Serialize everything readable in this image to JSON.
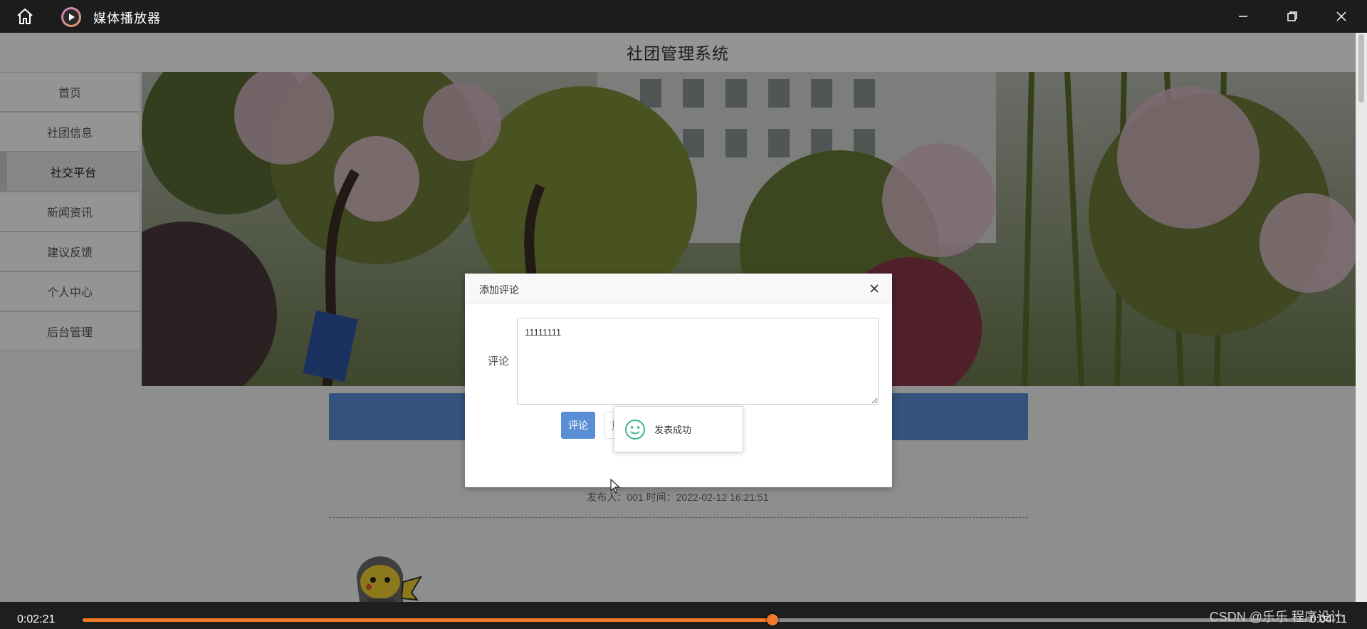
{
  "player": {
    "title": "媒体播放器",
    "current_time": "0:02:21",
    "total_time": "0:04:11",
    "progress": 0.5617,
    "accent": "#f07a2c"
  },
  "site": {
    "title": "社团管理系统",
    "nav": [
      {
        "label": "首页",
        "active": false
      },
      {
        "label": "社团信息",
        "active": false
      },
      {
        "label": "社交平台",
        "active": true
      },
      {
        "label": "新闻资讯",
        "active": false
      },
      {
        "label": "建议反馈",
        "active": false
      },
      {
        "label": "个人中心",
        "active": false
      },
      {
        "label": "后台管理",
        "active": false
      }
    ],
    "post_meta": "发布人：001 时间：2022-02-12 16:21:51",
    "accent": "#5a8fd6"
  },
  "modal": {
    "title": "添加评论",
    "field_label": "评论",
    "comment_value": "11111111",
    "submit_label": "评论",
    "reset_label": "重置"
  },
  "toast": {
    "message": "发表成功"
  },
  "watermark": "CSDN @乐乐 程序设计"
}
